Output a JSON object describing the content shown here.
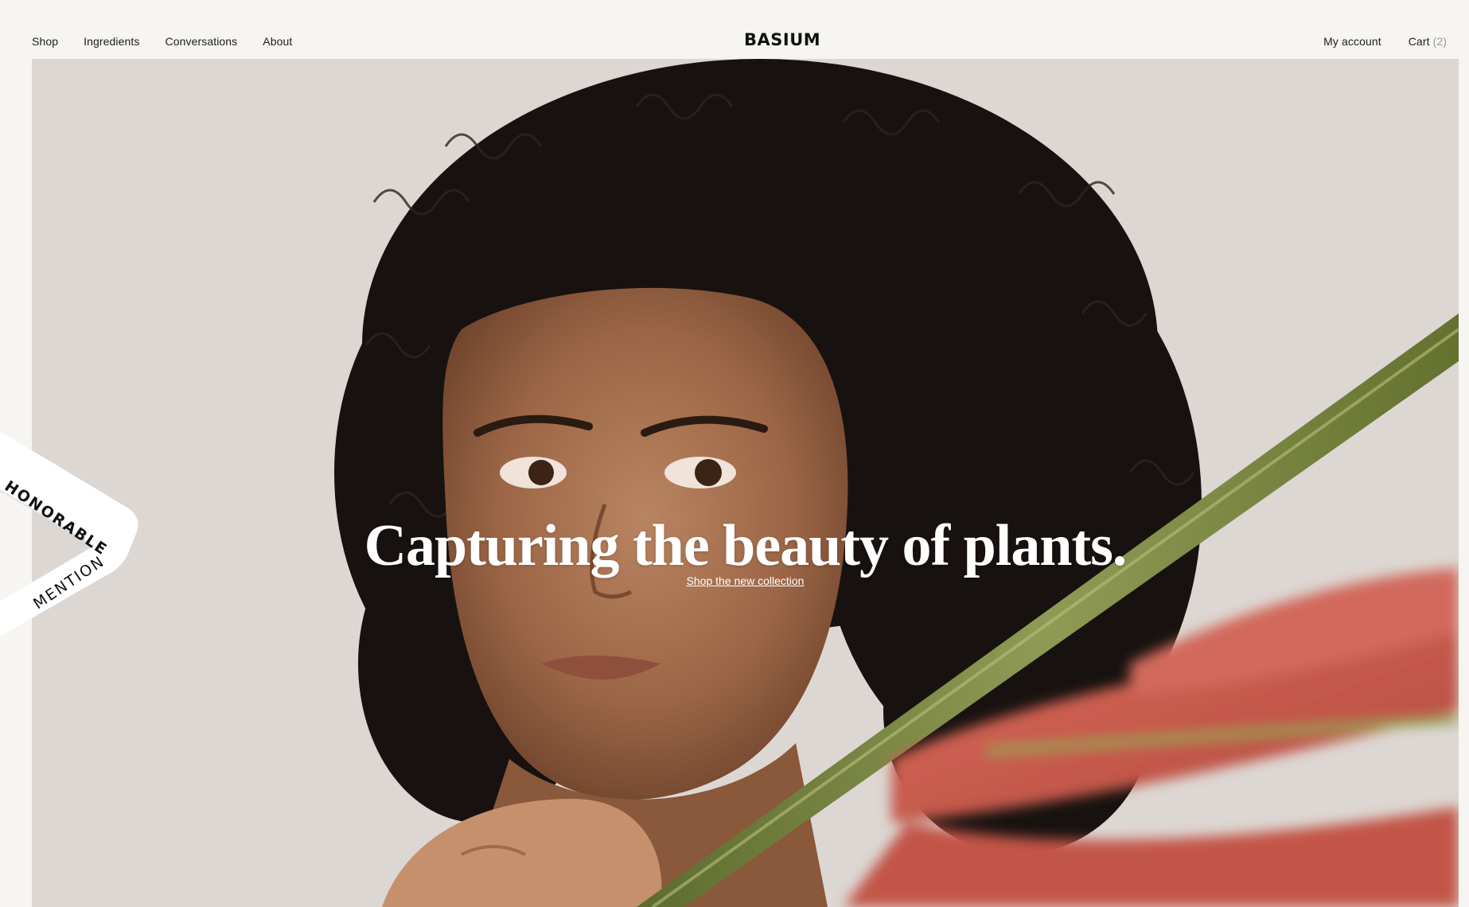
{
  "nav": {
    "left": [
      {
        "label": "Shop"
      },
      {
        "label": "Ingredients"
      },
      {
        "label": "Conversations"
      },
      {
        "label": "About"
      }
    ],
    "logo": "BASIUM",
    "account": "My account",
    "cart_label": "Cart",
    "cart_count": "(2)"
  },
  "hero": {
    "title": "Capturing the beauty of plants.",
    "cta": "Shop the new collection"
  },
  "badge": {
    "line1": "HONORABLE",
    "line2": "MENTION"
  },
  "colors": {
    "page_bg": "#f7f5f1",
    "hero_bg": "#ded8d4",
    "text_dark": "#1d1d1b",
    "hero_text": "#ffffff",
    "stem_green": "#7d8a45",
    "flower_red": "#c9584d"
  }
}
